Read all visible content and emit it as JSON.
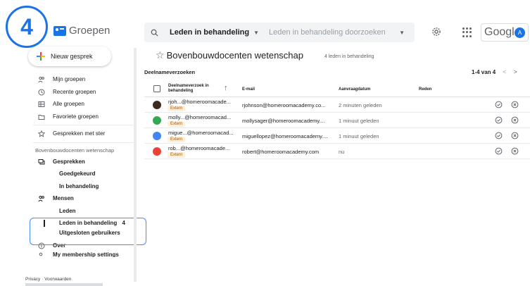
{
  "step_badge": "4",
  "app": {
    "name": "Groepen"
  },
  "search": {
    "scope": "Leden in behandeling",
    "placeholder": "Leden in behandeling doorzoeken"
  },
  "google": {
    "label": "Google",
    "avatar_letter": "A"
  },
  "sidebar": {
    "new_conversation": "Nieuw gesprek",
    "items": [
      {
        "label": "Mijn groepen",
        "icon": "people-icon"
      },
      {
        "label": "Recente groepen",
        "icon": "clock-icon"
      },
      {
        "label": "Alle groepen",
        "icon": "grid-icon"
      },
      {
        "label": "Favoriete groepen",
        "icon": "folder-icon"
      }
    ],
    "starred": {
      "label": "Gesprekken met ster",
      "icon": "star-icon"
    },
    "group_section_title": "Bovenbouwdocenten wetenschap",
    "conversations": {
      "label": "Gesprekken",
      "icon": "chat-icon"
    },
    "conv_sub": [
      "Goedgekeurd",
      "In behandeling"
    ],
    "people": {
      "label": "Mensen",
      "icon": "people-icon"
    },
    "people_sub": {
      "leden": "Leden",
      "pending": "Leden in behandeling",
      "pending_count": "4",
      "excluded": "Uitgesloten gebruikers"
    },
    "about": {
      "label": "Over",
      "icon": "info-icon"
    },
    "membership": {
      "label": "My membership settings"
    }
  },
  "footer": {
    "privacy": "Privacy",
    "terms": "Voorwaarden"
  },
  "main": {
    "title": "Bovenbouwdocenten wetenschap",
    "member_count": "4 leden in behandeling",
    "section": "Deelnameverzoeken",
    "pager": "1-4 van 4",
    "columns": {
      "request": "Deelnameverzoek in behandeling",
      "email": "E-mail",
      "date": "Aanvraagdatum",
      "reason": "Reden"
    },
    "rows": [
      {
        "name": "rjoh...@homeroomacade...",
        "tag": "Extern",
        "email": "rjohnson@homeroomacademy.co...",
        "date": "2 minuten geleden",
        "avatar_color": "#3c2a1e"
      },
      {
        "name": "molly...@homeroomacad...",
        "tag": "Extern",
        "email": "mollysager@homeroomacademy....",
        "date": "1 minuut geleden",
        "avatar_color": "#34a853"
      },
      {
        "name": "migue...@homeroomacad...",
        "tag": "Extern",
        "email": "miguellopez@homeroomacademy....",
        "date": "1 minuut geleden",
        "avatar_color": "#4285f4"
      },
      {
        "name": "rob...@homeroomacade...",
        "tag": "Extern",
        "email": "robert@homeroomacademy.com",
        "date": "nu",
        "avatar_color": "#ea4335"
      }
    ]
  }
}
